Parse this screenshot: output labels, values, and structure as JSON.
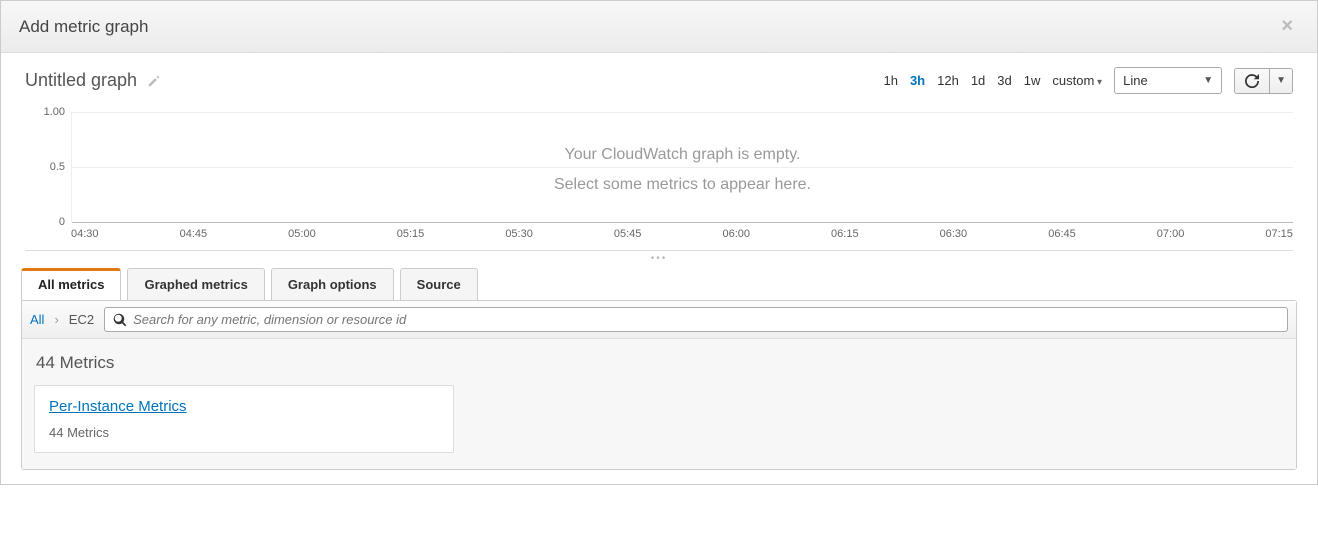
{
  "header": {
    "title": "Add metric graph"
  },
  "graph": {
    "title": "Untitled graph",
    "empty_line1": "Your CloudWatch graph is empty.",
    "empty_line2": "Select some metrics to appear here."
  },
  "time_ranges": [
    "1h",
    "3h",
    "12h",
    "1d",
    "3d",
    "1w",
    "custom"
  ],
  "time_active_index": 1,
  "chart_type": "Line",
  "tabs": [
    "All metrics",
    "Graphed metrics",
    "Graph options",
    "Source"
  ],
  "tabs_active_index": 0,
  "breadcrumb": {
    "root": "All",
    "current": "EC2"
  },
  "search": {
    "placeholder": "Search for any metric, dimension or resource id"
  },
  "metrics": {
    "count_label": "44 Metrics",
    "card_title": "Per-Instance Metrics",
    "card_sub": "44 Metrics"
  },
  "chart_data": {
    "type": "line",
    "series": [],
    "y_ticks": [
      "1.00",
      "0.5",
      "0"
    ],
    "x_ticks": [
      "04:30",
      "04:45",
      "05:00",
      "05:15",
      "05:30",
      "05:45",
      "06:00",
      "06:15",
      "06:30",
      "06:45",
      "07:00",
      "07:15"
    ],
    "ylim": [
      0,
      1
    ]
  }
}
